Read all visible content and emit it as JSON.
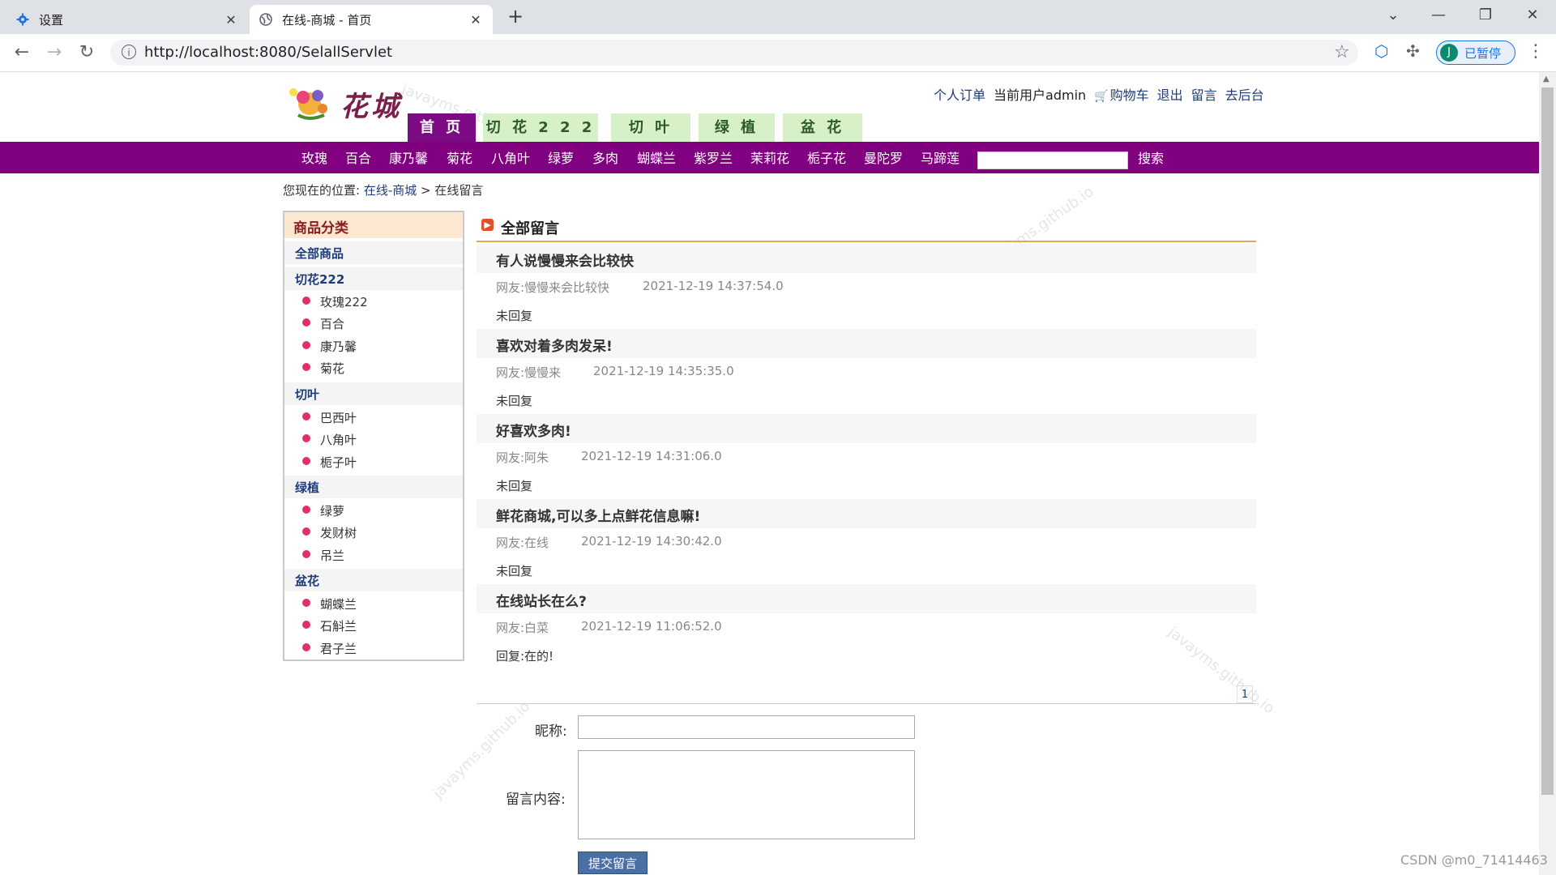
{
  "browser": {
    "tabs": [
      {
        "title": "设置",
        "icon": "gear-icon"
      },
      {
        "title": "在线-商城 - 首页",
        "icon": "globe-icon"
      }
    ],
    "url": "http://localhost:8080/SelallServlet",
    "profile_initial": "J",
    "profile_label": "已暂停"
  },
  "header": {
    "logo_text": "花城",
    "links": {
      "orders": "个人订单",
      "current_user": "当前用户admin",
      "cart": "购物车",
      "logout": "退出",
      "message": "留言",
      "backend": "去后台"
    },
    "nav_tabs": [
      "首 页",
      "切 花 2 2 2",
      "切 叶",
      "绿 植",
      "盆 花"
    ],
    "categories": [
      "玫瑰",
      "百合",
      "康乃馨",
      "菊花",
      "八角叶",
      "绿萝",
      "多肉",
      "蝴蝶兰",
      "紫罗兰",
      "茉莉花",
      "栀子花",
      "曼陀罗",
      "马蹄莲"
    ],
    "search_label": "搜索"
  },
  "breadcrumb": {
    "prefix": "您现在的位置:",
    "home": "在线-商城",
    "separator": ">",
    "current": "在线留言"
  },
  "sidebar": {
    "title": "商品分类",
    "all": "全部商品",
    "groups": [
      {
        "name": "切花222",
        "items": [
          "玫瑰222",
          "百合",
          "康乃馨",
          "菊花"
        ]
      },
      {
        "name": "切叶",
        "items": [
          "巴西叶",
          "八角叶",
          "栀子叶"
        ]
      },
      {
        "name": "绿植",
        "items": [
          "绿萝",
          "发财树",
          "吊兰"
        ]
      },
      {
        "name": "盆花",
        "items": [
          "蝴蝶兰",
          "石斛兰",
          "君子兰"
        ]
      }
    ]
  },
  "messages": {
    "title": "全部留言",
    "items": [
      {
        "title": "有人说慢慢来会比较快",
        "author": "网友:慢慢来会比较快",
        "time": "2021-12-19 14:37:54.0",
        "reply": "未回复"
      },
      {
        "title": "喜欢对着多肉发呆!",
        "author": "网友:慢慢来",
        "time": "2021-12-19 14:35:35.0",
        "reply": "未回复"
      },
      {
        "title": "好喜欢多肉!",
        "author": "网友:阿朱",
        "time": "2021-12-19 14:31:06.0",
        "reply": "未回复"
      },
      {
        "title": "鲜花商城,可以多上点鲜花信息嘛!",
        "author": "网友:在线",
        "time": "2021-12-19 14:30:42.0",
        "reply": "未回复"
      },
      {
        "title": "在线站长在么?",
        "author": "网友:白菜",
        "time": "2021-12-19 11:06:52.0",
        "reply": "回复:在的!"
      }
    ],
    "page": "1"
  },
  "form": {
    "nickname_label": "昵称:",
    "content_label": "留言内容:",
    "submit_label": "提交留言"
  },
  "watermark": "javayms.github.io",
  "footer_mark": "CSDN @m0_71414463"
}
